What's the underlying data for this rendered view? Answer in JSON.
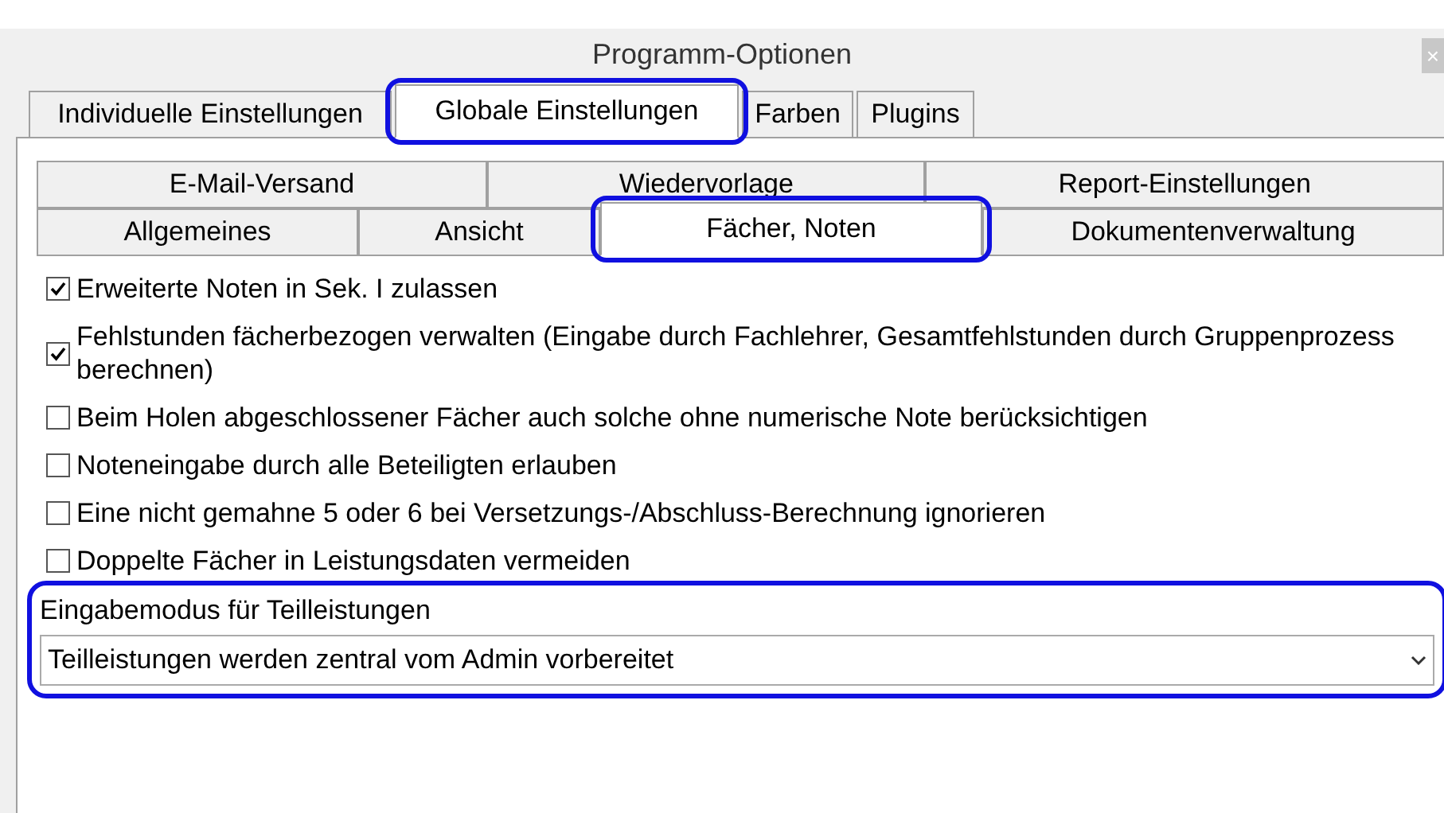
{
  "window": {
    "title": "Programm-Optionen",
    "close": "×"
  },
  "tabs": [
    {
      "label": "Individuelle Einstellungen",
      "selected": false,
      "highlighted": false
    },
    {
      "label": "Globale Einstellungen",
      "selected": true,
      "highlighted": true
    },
    {
      "label": "Farben",
      "selected": false,
      "highlighted": false
    },
    {
      "label": "Plugins",
      "selected": false,
      "highlighted": false
    }
  ],
  "subtab_rows": [
    [
      {
        "label": "E-Mail-Versand",
        "selected": false,
        "highlighted": false
      },
      {
        "label": "Wiedervorlage",
        "selected": false,
        "highlighted": false
      },
      {
        "label": "Report-Einstellungen",
        "selected": false,
        "highlighted": false
      }
    ],
    [
      {
        "label": "Allgemeines",
        "selected": false,
        "highlighted": false
      },
      {
        "label": "Ansicht",
        "selected": false,
        "highlighted": false
      },
      {
        "label": "Fächer, Noten",
        "selected": true,
        "highlighted": true
      },
      {
        "label": "Dokumentenverwaltung",
        "selected": false,
        "highlighted": false
      }
    ]
  ],
  "options": [
    {
      "label": "Erweiterte Noten in Sek. I zulassen",
      "checked": true
    },
    {
      "label": "Fehlstunden fächerbezogen verwalten (Eingabe durch Fachlehrer, Gesamtfehlstunden durch Gruppenprozess berechnen)",
      "checked": true
    },
    {
      "label": "Beim Holen abgeschlossener Fächer auch solche ohne numerische Note  berücksichtigen",
      "checked": false
    },
    {
      "label": "Noteneingabe durch alle Beteiligten erlauben",
      "checked": false
    },
    {
      "label": "Eine nicht gemahne 5 oder 6 bei Versetzungs-/Abschluss-Berechnung ignorieren",
      "checked": false
    },
    {
      "label": "Doppelte Fächer in Leistungsdaten vermeiden",
      "checked": false
    }
  ],
  "input_mode": {
    "label": "Eingabemodus für Teilleistungen",
    "value": "Teilleistungen werden zentral vom Admin vorbereitet",
    "highlighted": true
  }
}
